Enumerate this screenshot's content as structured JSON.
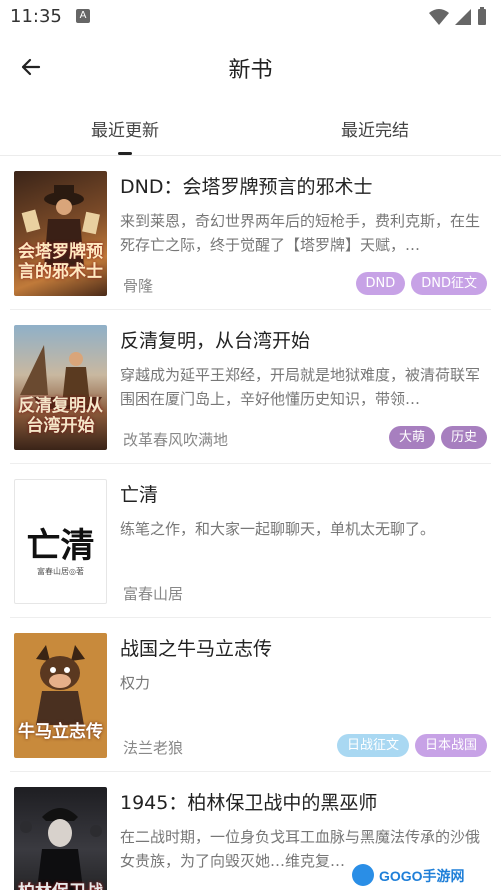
{
  "status_bar": {
    "time": "11:35",
    "notification_icon": "A"
  },
  "header": {
    "title": "新书",
    "back_icon": "arrow-left-icon"
  },
  "tabs": [
    {
      "label": "最近更新",
      "active": true
    },
    {
      "label": "最近完结",
      "active": false
    }
  ],
  "books": [
    {
      "title": "DND：会塔罗牌预言的邪术士",
      "description": "来到莱恩，奇幻世界两年后的短枪手，费利克斯，在生死存亡之际，终于觉醒了【塔罗牌】天赋，…",
      "author": "骨隆",
      "cover_text": "会塔罗牌预言的邪术士",
      "tags": [
        {
          "label": "DND",
          "color": "#c7a2e6"
        },
        {
          "label": "DND征文",
          "color": "#c7a2e6"
        }
      ]
    },
    {
      "title": "反清复明，从台湾开始",
      "description": "穿越成为延平王郑经，开局就是地狱难度，被清荷联军围困在厦门岛上，辛好他懂历史知识，带领…",
      "author": "改革春风吹满地",
      "cover_text": "反清复明从台湾开始",
      "tags": [
        {
          "label": "大萌",
          "color": "#a77fbf"
        },
        {
          "label": "历史",
          "color": "#a77fbf"
        }
      ]
    },
    {
      "title": "亡清",
      "description": "练笔之作，和大家一起聊聊天，单机太无聊了。",
      "author": "富春山居",
      "cover_text": "亡清",
      "cover_subtext": "富春山居◎著",
      "tags": []
    },
    {
      "title": "战国之牛马立志传",
      "description": "权力",
      "author": "法兰老狼",
      "cover_text": "牛马立志传",
      "tags": [
        {
          "label": "日战征文",
          "color": "#a9d8f2"
        },
        {
          "label": "日本战国",
          "color": "#c7a2e6"
        }
      ]
    },
    {
      "title": "1945：柏林保卫战中的黑巫师",
      "description": "在二战时期，一位身负戈耳工血脉与黑魔法传承的沙俄女贵族，为了向毁灭她…维克复…",
      "author": "",
      "cover_text": "柏林保卫战",
      "tags": []
    }
  ],
  "watermark": {
    "text": "GOGO手游网"
  }
}
